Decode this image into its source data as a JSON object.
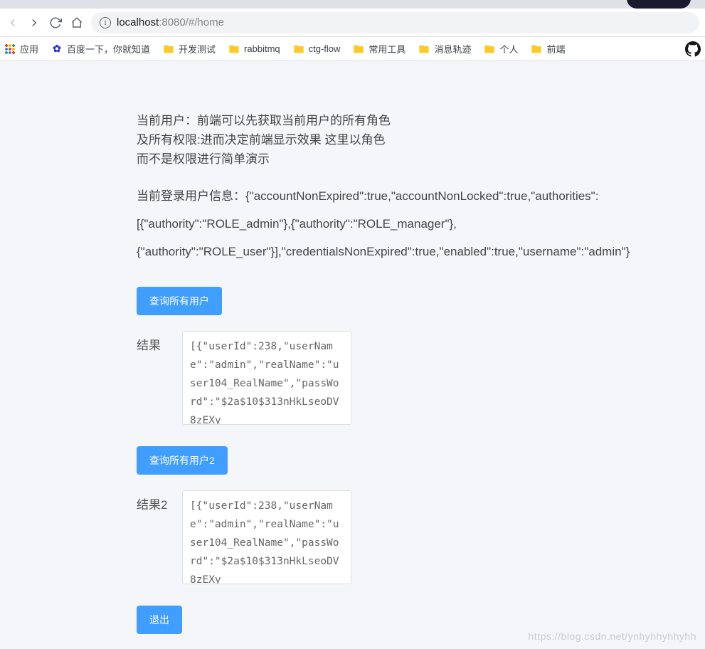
{
  "browser": {
    "url_host": "localhost",
    "url_port": ":8080",
    "url_path": "/#/home"
  },
  "bookmarks": {
    "apps": "应用",
    "baidu": "百度一下，你就知道",
    "items": [
      {
        "label": "开发测试"
      },
      {
        "label": "rabbitmq"
      },
      {
        "label": "ctg-flow"
      },
      {
        "label": "常用工具"
      },
      {
        "label": "消息轨迹"
      },
      {
        "label": "个人"
      },
      {
        "label": "前端"
      }
    ]
  },
  "page": {
    "intro_line1": "当前用户：前端可以先获取当前用户的所有角色",
    "intro_line2": "及所有权限:进而决定前端显示效果 这里以角色",
    "intro_line3": "而不是权限进行简单演示",
    "userinfo_line1": "当前登录用户信息：{\"accountNonExpired\":true,\"accountNonLocked\":true,\"authorities\":",
    "userinfo_line2": "[{\"authority\":\"ROLE_admin\"},{\"authority\":\"ROLE_manager\"},",
    "userinfo_line3": "{\"authority\":\"ROLE_user\"}],\"credentialsNonExpired\":true,\"enabled\":true,\"username\":\"admin\"}",
    "query1_btn": "查询所有用户",
    "result1_label": "结果",
    "result1_value": "[{\"userId\":238,\"userName\":\"admin\",\"realName\":\"user104_RealName\",\"passWord\":\"$2a$10$313nHkLseoDV8zEXy",
    "query2_btn": "查询所有用户2",
    "result2_label": "结果2",
    "result2_value": "[{\"userId\":238,\"userName\":\"admin\",\"realName\":\"user104_RealName\",\"passWord\":\"$2a$10$313nHkLseoDV8zEXy",
    "logout_btn": "退出"
  },
  "watermark": "https://blog.csdn.net/ynhyhhyhhyhh"
}
